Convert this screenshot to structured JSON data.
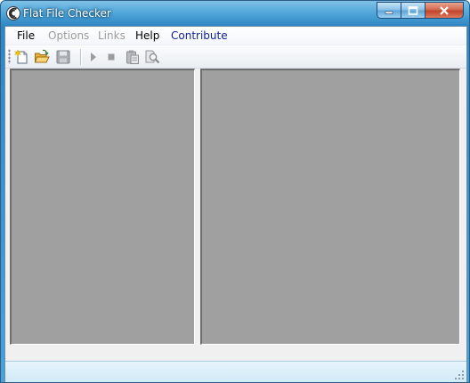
{
  "window": {
    "title": "Flat File Checker"
  },
  "menu": {
    "items": [
      {
        "label": "File",
        "state": "enabled"
      },
      {
        "label": "Options",
        "state": "disabled"
      },
      {
        "label": "Links",
        "state": "disabled"
      },
      {
        "label": "Help",
        "state": "enabled"
      },
      {
        "label": "Contribute",
        "state": "link"
      }
    ]
  },
  "toolbar": {
    "buttons": [
      {
        "icon": "new-file-icon",
        "enabled": true
      },
      {
        "icon": "open-folder-icon",
        "enabled": true
      },
      {
        "icon": "save-icon",
        "enabled": false
      },
      {
        "icon": "play-icon",
        "enabled": false
      },
      {
        "icon": "stop-icon",
        "enabled": false
      },
      {
        "icon": "paste-icon",
        "enabled": false
      },
      {
        "icon": "find-icon",
        "enabled": false
      }
    ]
  },
  "colors": {
    "title_bar": "#3b8fcb",
    "pane_background": "#a0a0a0",
    "client_background": "#f0f0f0",
    "contribute_link": "#0d1f9e",
    "disabled_text": "#9c9c9c"
  }
}
